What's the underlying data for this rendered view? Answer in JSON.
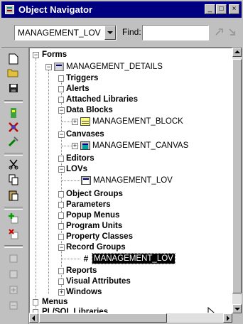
{
  "window": {
    "title": "Object Navigator",
    "minimize_glyph": "_",
    "maximize_glyph": "□",
    "close_glyph": "×"
  },
  "toolbar": {
    "module_select_value": "MANAGEMENT_LOV",
    "find_label": "Find:",
    "find_value": ""
  },
  "tree": {
    "forms": "Forms",
    "module": "MANAGEMENT_DETAILS",
    "triggers": "Triggers",
    "alerts": "Alerts",
    "attached_libraries": "Attached Libraries",
    "data_blocks": "Data Blocks",
    "block": "MANAGEMENT_BLOCK",
    "canvases": "Canvases",
    "canvas": "MANAGEMENT_CANVAS",
    "editors": "Editors",
    "lovs": "LOVs",
    "lov": "MANAGEMENT_LOV",
    "object_groups": "Object Groups",
    "parameters": "Parameters",
    "popup_menus": "Popup Menus",
    "program_units": "Program Units",
    "property_classes": "Property Classes",
    "record_groups": "Record Groups",
    "record_group": "MANAGEMENT_LOV",
    "reports": "Reports",
    "visual_attributes": "Visual Attributes",
    "windows": "Windows",
    "menus": "Menus",
    "plsql_libraries": "PL/SQL Libraries"
  },
  "colors": {
    "titlebar": "#000080",
    "selection": "#000000"
  }
}
